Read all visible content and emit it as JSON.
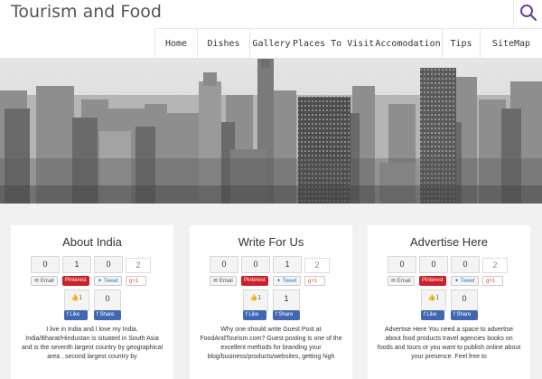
{
  "header": {
    "site_title": "Tourism and Food",
    "search_icon": "search-icon",
    "accent_color": "#6b3fa0"
  },
  "nav": {
    "items": [
      {
        "label": "Home"
      },
      {
        "label": "Dishes"
      },
      {
        "label": "Gallery"
      },
      {
        "label": "Places To Visit"
      },
      {
        "label": "Accomodation"
      },
      {
        "label": "Tips"
      },
      {
        "label": "SiteMap"
      }
    ]
  },
  "hero": {
    "image": "city-skyline-banner"
  },
  "cards": [
    {
      "title": "About India",
      "counts": {
        "email": "0",
        "pinterest": "1",
        "tweet": "0",
        "gplus": "2",
        "like": "1",
        "share": "0"
      },
      "buttons": {
        "email": "Email",
        "pinterest": "Pinterest",
        "tweet": "Tweet",
        "gplus": "g+1",
        "like": "Like",
        "share": "Share"
      },
      "text": "I live in India and I love my India. India/Bharat/Hindustan is situated in South Asia and is the seventh largest country by geographical area , second largest country by"
    },
    {
      "title": "Write For Us",
      "counts": {
        "email": "0",
        "pinterest": "0",
        "tweet": "1",
        "gplus": "2",
        "like": "1",
        "share": "1"
      },
      "buttons": {
        "email": "Email",
        "pinterest": "Pinterest",
        "tweet": "Tweet",
        "gplus": "g+1",
        "like": "Like",
        "share": "Share"
      },
      "text": "Why one should write Guest Post at FoodAndTourism.com? Guest posting is one of the excellent methods for branding your blog/business/products/websites, getting high"
    },
    {
      "title": "Advertise Here",
      "counts": {
        "email": "0",
        "pinterest": "0",
        "tweet": "0",
        "gplus": "2",
        "like": "1",
        "share": "0"
      },
      "buttons": {
        "email": "Email",
        "pinterest": "Pinterest",
        "tweet": "Tweet",
        "gplus": "g+1",
        "like": "Like",
        "share": "Share"
      },
      "text": "Advertise Here You need a space to advertise about food products travel agencies books on foods and tours or you want to publish online about your presence. Feel free to"
    }
  ]
}
